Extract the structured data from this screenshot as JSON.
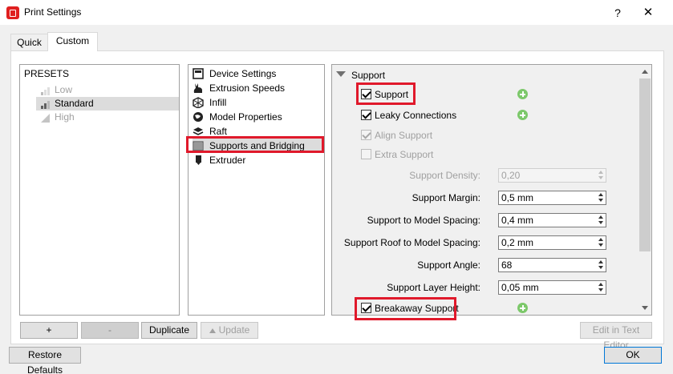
{
  "window": {
    "title": "Print Settings",
    "help_label": "?",
    "close_label": "✕"
  },
  "tabs": [
    {
      "label": "Quick",
      "active": false
    },
    {
      "label": "Custom",
      "active": true
    }
  ],
  "presets": {
    "title": "PRESETS",
    "items": [
      {
        "label": "Low",
        "state": "disabled"
      },
      {
        "label": "Standard",
        "state": "selected"
      },
      {
        "label": "High",
        "state": "disabled"
      }
    ]
  },
  "categories": [
    {
      "label": "Device Settings",
      "icon": "printer-icon"
    },
    {
      "label": "Extrusion Speeds",
      "icon": "rabbit-icon"
    },
    {
      "label": "Infill",
      "icon": "infill-cube-icon"
    },
    {
      "label": "Model Properties",
      "icon": "globe-icon"
    },
    {
      "label": "Raft",
      "icon": "layers-icon"
    },
    {
      "label": "Supports and Bridging",
      "icon": "supports-icon",
      "selected": true
    },
    {
      "label": "Extruder",
      "icon": "extruder-icon"
    }
  ],
  "settings": {
    "section_label": "Support",
    "checkboxes": [
      {
        "label": "Support",
        "checked": true,
        "disabled": false,
        "has_plus": true
      },
      {
        "label": "Leaky Connections",
        "checked": true,
        "disabled": false,
        "has_plus": true
      },
      {
        "label": "Align Support",
        "checked": true,
        "disabled": true,
        "has_plus": false
      },
      {
        "label": "Extra Support",
        "checked": false,
        "disabled": true,
        "has_plus": false
      }
    ],
    "fields": [
      {
        "label": "Support Density:",
        "value": "0,20",
        "disabled": true
      },
      {
        "label": "Support Margin:",
        "value": "0,5 mm",
        "disabled": false
      },
      {
        "label": "Support to Model Spacing:",
        "value": "0,4 mm",
        "disabled": false
      },
      {
        "label": "Support Roof to Model Spacing:",
        "value": "0,2 mm",
        "disabled": false
      },
      {
        "label": "Support Angle:",
        "value": "68",
        "disabled": false
      },
      {
        "label": "Support Layer Height:",
        "value": "0,05 mm",
        "disabled": false
      }
    ],
    "bottom_checkbox": {
      "label": "Breakaway Support",
      "checked": true,
      "has_plus": true
    }
  },
  "buttons": {
    "add": "+",
    "remove": "-",
    "duplicate": "Duplicate",
    "update": "Update",
    "edit_in_text_editor": "Edit in Text Editor",
    "restore_defaults": "Restore Defaults",
    "ok": "OK"
  },
  "colors": {
    "highlight_box": "#e0192b",
    "plus_icon": "#7cc86a",
    "app_icon": "#e02020"
  }
}
